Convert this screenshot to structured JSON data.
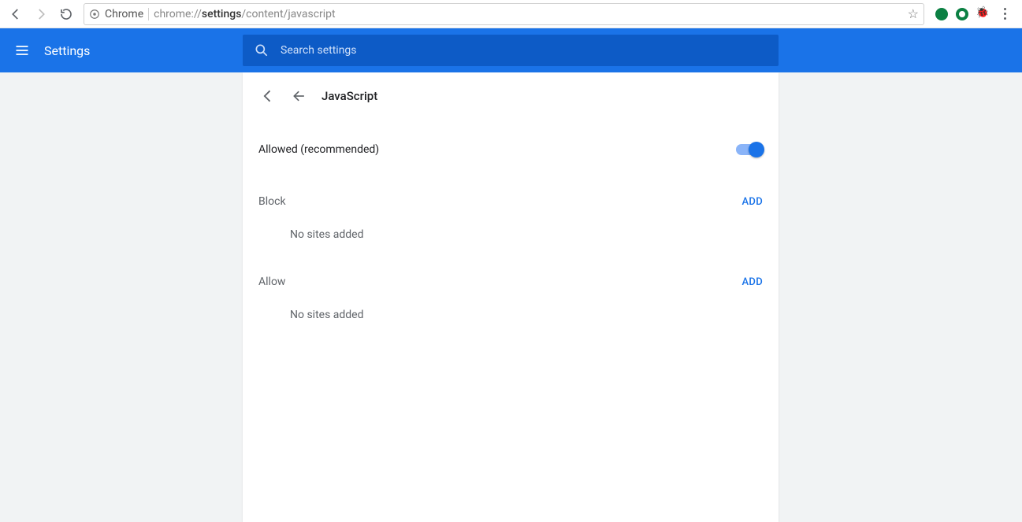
{
  "browser": {
    "origin_label": "Chrome",
    "url_prefix": "chrome://",
    "url_bold": "settings",
    "url_suffix": "/content/javascript"
  },
  "header": {
    "title": "Settings",
    "search_placeholder": "Search settings"
  },
  "page": {
    "title": "JavaScript",
    "toggle_label": "Allowed (recommended)",
    "toggle_on": true,
    "sections": [
      {
        "label": "Block",
        "action": "ADD",
        "empty": "No sites added"
      },
      {
        "label": "Allow",
        "action": "ADD",
        "empty": "No sites added"
      }
    ]
  }
}
